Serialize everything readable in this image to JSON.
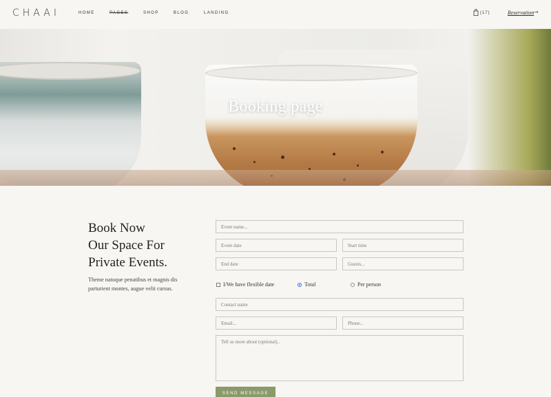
{
  "brand": {
    "logo": "CHAAI"
  },
  "nav": {
    "items": [
      {
        "label": "HOME",
        "active": false
      },
      {
        "label": "PAGES",
        "active": true
      },
      {
        "label": "SHOP",
        "active": false
      },
      {
        "label": "BLOG",
        "active": false
      },
      {
        "label": "LANDING",
        "active": false
      }
    ],
    "cart_count": "(17)",
    "reservation": "Reservation",
    "reservation_arrow": "→"
  },
  "hero": {
    "title": "Booking page"
  },
  "intro": {
    "title_lines": [
      "Book Now",
      "Our Space For",
      "Private Events."
    ],
    "text": "Theme natoque penatibus et magnis dis parturient montes, augue velit cursus."
  },
  "form": {
    "event_name": {
      "placeholder": "Event name..."
    },
    "event_date": {
      "placeholder": "Event date"
    },
    "start_time": {
      "placeholder": "Start time"
    },
    "end_date": {
      "placeholder": "End date"
    },
    "guests": {
      "placeholder": "Guests..."
    },
    "flexible_dates": {
      "label": "I/We have flexible date",
      "checked": false
    },
    "pricing": {
      "total_label": "Total",
      "per_person_label": "Per person",
      "selected": "Total"
    },
    "contact_name": {
      "placeholder": "Contact name"
    },
    "email": {
      "placeholder": "Email..."
    },
    "phone": {
      "placeholder": "Phone..."
    },
    "message": {
      "placeholder": "Tell us more about (optional).."
    },
    "submit_label": "SEND MESSAGE"
  },
  "colors": {
    "background": "#f7f6f2",
    "accent_button": "#8a9a6a",
    "radio_selected": "#3b6fd9"
  },
  "icons": {
    "cart": "shopping-bag-icon",
    "arrow": "arrow-right-icon"
  }
}
